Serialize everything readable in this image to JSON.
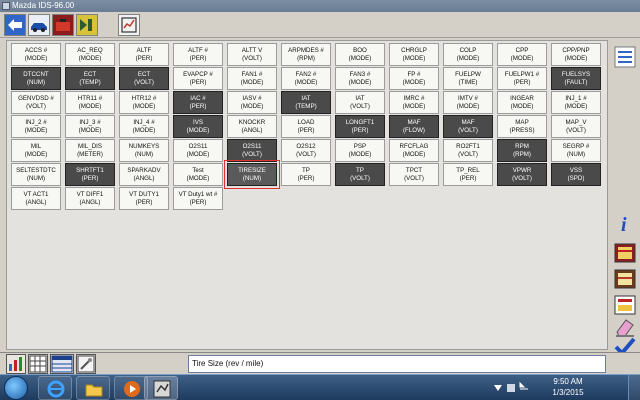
{
  "window": {
    "title": "Mazda IDS-96.00"
  },
  "toolbar": {
    "buttons": [
      {
        "icon": "back-arrow-icon"
      },
      {
        "icon": "vehicle-icon"
      },
      {
        "icon": "toolbox-icon"
      },
      {
        "icon": "forward-arrow-icon"
      },
      {
        "icon": "datalogger-icon"
      }
    ]
  },
  "pids": [
    {
      "name": "ACCS #",
      "unit": "(MODE)",
      "dark": false
    },
    {
      "name": "AC_REQ",
      "unit": "(MODE)",
      "dark": false
    },
    {
      "name": "ALTF",
      "unit": "(PER)",
      "dark": false
    },
    {
      "name": "ALTF #",
      "unit": "(PER)",
      "dark": false
    },
    {
      "name": "ALTT V",
      "unit": "(VOLT)",
      "dark": false
    },
    {
      "name": "ARPMDES #",
      "unit": "(RPM)",
      "dark": false
    },
    {
      "name": "BOO",
      "unit": "(MODE)",
      "dark": false
    },
    {
      "name": "CHRGLP",
      "unit": "(MODE)",
      "dark": false
    },
    {
      "name": "COLP",
      "unit": "(MODE)",
      "dark": false
    },
    {
      "name": "CPP",
      "unit": "(MODE)",
      "dark": false
    },
    {
      "name": "CPP/PNP",
      "unit": "(MODE)",
      "dark": false
    },
    {
      "name": "DTCCNT",
      "unit": "(NUM)",
      "dark": true
    },
    {
      "name": "ECT",
      "unit": "(TEMP)",
      "dark": true
    },
    {
      "name": "ECT",
      "unit": "(VOLT)",
      "dark": true
    },
    {
      "name": "EVAPCP #",
      "unit": "(PER)",
      "dark": false
    },
    {
      "name": "FAN1 #",
      "unit": "(MODE)",
      "dark": false
    },
    {
      "name": "FAN2 #",
      "unit": "(MODE)",
      "dark": false
    },
    {
      "name": "FAN3 #",
      "unit": "(MODE)",
      "dark": false
    },
    {
      "name": "FP #",
      "unit": "(MODE)",
      "dark": false
    },
    {
      "name": "FUELPW",
      "unit": "(TIME)",
      "dark": false
    },
    {
      "name": "FUELPW1 #",
      "unit": "(PER)",
      "dark": false
    },
    {
      "name": "FUELSYS",
      "unit": "(FAULT)",
      "dark": true
    },
    {
      "name": "GENVDSD #",
      "unit": "(VOLT)",
      "dark": false
    },
    {
      "name": "HTR11 #",
      "unit": "(MODE)",
      "dark": false
    },
    {
      "name": "HTR12 #",
      "unit": "(MODE)",
      "dark": false
    },
    {
      "name": "IAC #",
      "unit": "(PER)",
      "dark": true
    },
    {
      "name": "IASV #",
      "unit": "(MODE)",
      "dark": false
    },
    {
      "name": "IAT",
      "unit": "(TEMP)",
      "dark": true
    },
    {
      "name": "IAT",
      "unit": "(VOLT)",
      "dark": false
    },
    {
      "name": "IMRC #",
      "unit": "(MODE)",
      "dark": false
    },
    {
      "name": "IMTV #",
      "unit": "(MODE)",
      "dark": false
    },
    {
      "name": "INGEAR",
      "unit": "(MODE)",
      "dark": false
    },
    {
      "name": "INJ_1 #",
      "unit": "(MODE)",
      "dark": false
    },
    {
      "name": "INJ_2 #",
      "unit": "(MODE)",
      "dark": false
    },
    {
      "name": "INJ_3 #",
      "unit": "(MODE)",
      "dark": false
    },
    {
      "name": "INJ_4 #",
      "unit": "(MODE)",
      "dark": false
    },
    {
      "name": "IVS",
      "unit": "(MODE)",
      "dark": true
    },
    {
      "name": "KNOCKR",
      "unit": "(ANGL)",
      "dark": false
    },
    {
      "name": "LOAD",
      "unit": "(PER)",
      "dark": false
    },
    {
      "name": "LONGFT1",
      "unit": "(PER)",
      "dark": true
    },
    {
      "name": "MAF",
      "unit": "(FLOW)",
      "dark": true
    },
    {
      "name": "MAF",
      "unit": "(VOLT)",
      "dark": true
    },
    {
      "name": "MAP",
      "unit": "(PRESS)",
      "dark": false
    },
    {
      "name": "MAP_V",
      "unit": "(VOLT)",
      "dark": false
    },
    {
      "name": "MIL",
      "unit": "(MODE)",
      "dark": false
    },
    {
      "name": "MIL_DIS",
      "unit": "(METER)",
      "dark": false
    },
    {
      "name": "NUMKEYS",
      "unit": "(NUM)",
      "dark": false
    },
    {
      "name": "O2S11",
      "unit": "(MODE)",
      "dark": false
    },
    {
      "name": "O2S11",
      "unit": "(VOLT)",
      "dark": true
    },
    {
      "name": "O2S12",
      "unit": "(VOLT)",
      "dark": false
    },
    {
      "name": "PSP",
      "unit": "(MODE)",
      "dark": false
    },
    {
      "name": "RFCFLAG",
      "unit": "(MODE)",
      "dark": false
    },
    {
      "name": "RO2FT1",
      "unit": "(VOLT)",
      "dark": false
    },
    {
      "name": "RPM",
      "unit": "(RPM)",
      "dark": true
    },
    {
      "name": "SEGRP #",
      "unit": "(NUM)",
      "dark": false
    },
    {
      "name": "SELTESTDTC",
      "unit": "(NUM)",
      "dark": false
    },
    {
      "name": "SHRTFT1",
      "unit": "(PER)",
      "dark": true
    },
    {
      "name": "SPARKADV",
      "unit": "(ANGL)",
      "dark": false
    },
    {
      "name": "Test",
      "unit": "(MODE)",
      "dark": false
    },
    {
      "name": "TIRESIZE",
      "unit": "(NUM)",
      "dark": true,
      "selected": true
    },
    {
      "name": "TP",
      "unit": "(PER)",
      "dark": false
    },
    {
      "name": "TP",
      "unit": "(VOLT)",
      "dark": true
    },
    {
      "name": "TPCT",
      "unit": "(VOLT)",
      "dark": false
    },
    {
      "name": "TP_REL",
      "unit": "(PER)",
      "dark": false
    },
    {
      "name": "VPWR",
      "unit": "(VOLT)",
      "dark": true
    },
    {
      "name": "VSS",
      "unit": "(SPD)",
      "dark": true
    },
    {
      "name": "VT ACT1",
      "unit": "(ANGL)",
      "dark": false
    },
    {
      "name": "VT DIFF1",
      "unit": "(ANGL)",
      "dark": false
    },
    {
      "name": "VT DUTY1",
      "unit": "(PER)",
      "dark": false
    },
    {
      "name": "VT Duty1 wt #",
      "unit": "(PER)",
      "dark": false
    }
  ],
  "sidebar": {
    "buttons": [
      {
        "icon": "list-view-icon"
      },
      {
        "icon": "info-icon"
      },
      {
        "icon": "book-icon"
      },
      {
        "icon": "notes-icon"
      },
      {
        "icon": "clipboard-icon"
      },
      {
        "icon": "eraser-icon"
      },
      {
        "icon": "checkmark-icon"
      }
    ]
  },
  "bottom": {
    "buttons": [
      {
        "icon": "bar-graph-icon"
      },
      {
        "icon": "grid-view-icon"
      },
      {
        "icon": "table-view-icon"
      },
      {
        "icon": "tool-icon"
      }
    ],
    "description": "Tire Size (rev / mile)"
  },
  "taskbar": {
    "items": [
      {
        "icon": "internet-explorer-icon"
      },
      {
        "icon": "folder-icon"
      },
      {
        "icon": "media-player-icon"
      },
      {
        "icon": "ids-app-icon"
      }
    ],
    "time": "9:50 AM",
    "date": "1/3/2015"
  }
}
